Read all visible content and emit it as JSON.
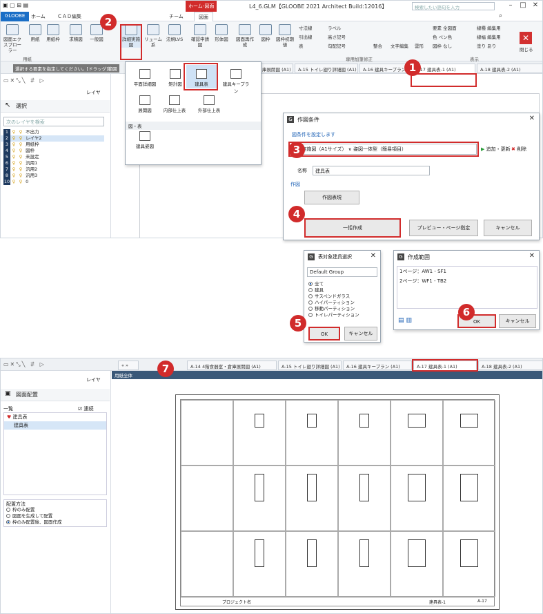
{
  "top_window": {
    "title": "L4_6.GLM【GLOOBE 2021 Architect Build:12016】",
    "context_tab_label": "ホーム-図面",
    "ribbon_tabs": [
      "GLOOBE",
      "ホーム",
      "ＣＡＤ編集",
      "チーム",
      "図面"
    ],
    "search_placeholder": "検索したい語句を入力",
    "ribbon_buttons": [
      {
        "label": "図面エクスプローラー"
      },
      {
        "label": "用紙"
      },
      {
        "label": "用紙枠"
      },
      {
        "label": "求積図"
      },
      {
        "label": "一般図"
      },
      {
        "label": "詳細実施図"
      },
      {
        "label": "リューム系"
      },
      {
        "label": "法規LVS"
      },
      {
        "label": "確認申請図"
      },
      {
        "label": "形体図"
      },
      {
        "label": "図面再作成"
      },
      {
        "label": "図枠"
      },
      {
        "label": "図枠初期値"
      }
    ],
    "annot_cmds": [
      "寸法線",
      "ラベル",
      "引出線",
      "高さ記号",
      "表",
      "勾配記号"
    ],
    "annot_group_label": "専用加筆修正",
    "mid_cmds": [
      "整合",
      "文字編集",
      "雲形"
    ],
    "display_cmds": [
      "要素 全図面",
      "色 ペン色",
      "図枠 なし"
    ],
    "display_cmds2": [
      "線種 編集用",
      "線幅 編集用",
      "塗り あり"
    ],
    "display_group_label": "表示",
    "close_label": "閉じる",
    "ribbon_group_paper": "用紙",
    "left_tool_hint": "選択する要素を指定してください。[ドラッグ]範囲",
    "left_layer_label": "レイヤ",
    "select_label": "選択",
    "layer_search_placeholder": "次のレイヤを検索",
    "layers": [
      {
        "num": "1",
        "name": "不出力"
      },
      {
        "num": "2",
        "name": "レイヤ2"
      },
      {
        "num": "3",
        "name": "用紙枠"
      },
      {
        "num": "4",
        "name": "図枠"
      },
      {
        "num": "5",
        "name": "未設定"
      },
      {
        "num": "6",
        "name": "汎用1"
      },
      {
        "num": "7",
        "name": "汎用2"
      },
      {
        "num": "8",
        "name": "汎用3"
      },
      {
        "num": "10",
        "name": "0"
      }
    ],
    "doc_tabs": [
      "庫展開図 (A1)",
      "A-15 トイレ廻り詳細図 (A1)",
      "A-16 建具キープラン (A1)",
      "A-17 建具表-1 (A1)",
      "A-18 建具表-2 (A1)"
    ],
    "dropdown": {
      "items_row1": [
        "平面詳細図",
        "矩計図",
        "建具表",
        "建具キープラン"
      ],
      "items_row2": [
        "展開図",
        "内部仕上表",
        "外部仕上表"
      ],
      "section_label": "図・表",
      "items_row3": [
        "建具姿図"
      ]
    }
  },
  "dialog_conditions": {
    "title": "作図条件",
    "hint": "図条件を設定します",
    "select_value": "01_実施図（A1サイズ） ∨ 姿図一体型（簡易項目）",
    "add_update": "追加・更新",
    "delete": "削除",
    "name_label": "名称",
    "name_value": "建具表",
    "drawing_label": "作図",
    "expression_button": "作図表現",
    "batch_button": "一括作成",
    "preview_button": "プレビュー・ページ指定",
    "cancel_button": "キャンセル"
  },
  "dialog_select": {
    "title": "表対象建具選択",
    "group_value": "Default Group",
    "options": [
      "全て",
      "建具",
      "サスペンドガラス",
      "ハイパーティション",
      "移動パーティション",
      "トイレパーティション"
    ],
    "selected_index": 0,
    "ok": "OK",
    "cancel": "キャンセル"
  },
  "dialog_range": {
    "title": "作成範囲",
    "rows": [
      "1ページ：AW1 - SF1",
      "2ページ：WF1 - TB2"
    ],
    "ok": "OK",
    "cancel": "キャンセル"
  },
  "bottom_window": {
    "tabs_prefix": "用紙全体",
    "doc_tabs": [
      "A-14 4階食器室・倉庫展開図 (A1)",
      "A-15 トイレ廻り詳細図 (A1)",
      "A-16 建具キープラン (A1)",
      "A-17 建具表-1 (A1)",
      "A-18 建具表-2 (A1)"
    ],
    "panel_title": "図面配置",
    "list_header": "一覧",
    "continuous_label": "連続",
    "list_items": [
      "建具表",
      "建具表"
    ],
    "placement_label": "配置方法",
    "placement_options": [
      "枠のみ配置",
      "図面を生成して配置",
      "枠のみ配置後、図面作成"
    ],
    "placement_selected": 2,
    "sheet_project": "プロジェクト名",
    "sheet_name": "建具表-1",
    "sheet_no": "A-17",
    "layer_label": "レイヤ"
  },
  "callouts": [
    "1",
    "2",
    "3",
    "4",
    "5",
    "6",
    "7"
  ],
  "colors": {
    "accent": "#d12b2b",
    "gloobe_blue": "#1a6ec6",
    "layer_num_bg": "#1e3a5f"
  }
}
